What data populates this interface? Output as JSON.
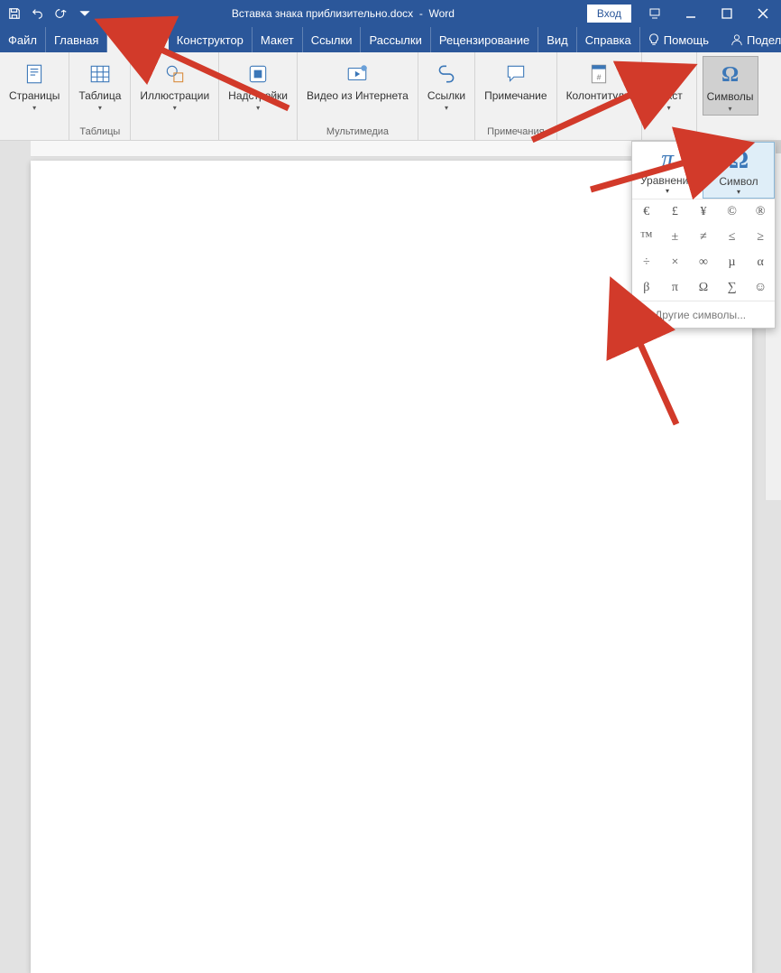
{
  "title": {
    "doc": "Вставка знака приблизительно.docx",
    "sep": "-",
    "app": "Word"
  },
  "qat": {
    "save": "save",
    "undo": "undo",
    "redo": "redo"
  },
  "login": "Вход",
  "tabs": {
    "file": "Файл",
    "home": "Главная",
    "insert": "Вставка",
    "design": "Конструктор",
    "layout": "Макет",
    "references": "Ссылки",
    "mailings": "Рассылки",
    "review": "Рецензирование",
    "view": "Вид",
    "help": "Справка",
    "tell": "Помощь",
    "share": "Поделиться"
  },
  "ribbon": {
    "pages": {
      "label": "Страницы",
      "group": ""
    },
    "tables": {
      "label": "Таблица",
      "group": "Таблицы"
    },
    "illustrations": {
      "label": "Иллюстрации",
      "group": ""
    },
    "addins": {
      "label": "Надстройки",
      "group": ""
    },
    "media": {
      "label": "Видео из Интернета",
      "group": "Мультимедиа"
    },
    "links": {
      "label": "Ссылки",
      "group": ""
    },
    "comments": {
      "label": "Примечание",
      "group": "Примечания"
    },
    "headerfooter": {
      "label": "Колонтитулы",
      "group": ""
    },
    "text": {
      "label": "Текст",
      "group": ""
    },
    "symbols": {
      "label": "Символы",
      "group": ""
    }
  },
  "symdrop": {
    "equation": "Уравнение",
    "symbol": "Символ",
    "more": "Другие символы..."
  },
  "symbols_grid": [
    "€",
    "£",
    "¥",
    "©",
    "®",
    "™",
    "±",
    "≠",
    "≤",
    "≥",
    "÷",
    "×",
    "∞",
    "µ",
    "α",
    "β",
    "π",
    "Ω",
    "∑",
    "☺"
  ],
  "colors": {
    "brand": "#2b579a",
    "accent": "#3b77b8"
  }
}
